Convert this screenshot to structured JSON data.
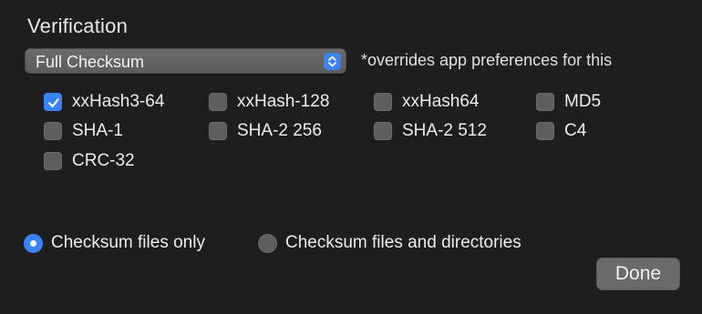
{
  "verification": {
    "title": "Verification",
    "mode_select": {
      "value": "Full Checksum",
      "hint": "*overrides app preferences for this"
    },
    "algorithms": [
      {
        "label": "xxHash3-64",
        "checked": true
      },
      {
        "label": "xxHash-128",
        "checked": false
      },
      {
        "label": "xxHash64",
        "checked": false
      },
      {
        "label": "MD5",
        "checked": false
      },
      {
        "label": "SHA-1",
        "checked": false
      },
      {
        "label": "SHA-2 256",
        "checked": false
      },
      {
        "label": "SHA-2 512",
        "checked": false
      },
      {
        "label": "C4",
        "checked": false
      },
      {
        "label": "CRC-32",
        "checked": false
      }
    ],
    "scope": {
      "options": [
        {
          "label": "Checksum files only",
          "selected": true
        },
        {
          "label": "Checksum files and directories",
          "selected": false
        }
      ]
    }
  },
  "actions": {
    "done_label": "Done"
  },
  "colors": {
    "accent": "#3a82f7",
    "background": "#1e1e1e"
  }
}
